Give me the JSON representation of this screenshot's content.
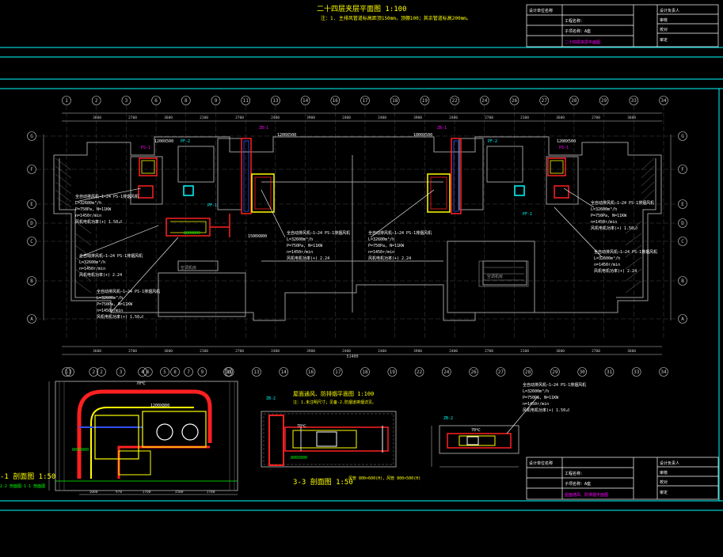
{
  "drawing": {
    "main_title": "二十四层夹层平面图 1:100",
    "main_note": "注：1. 主排风管道标高距顶150mm，顶棚100；其余管道标高200mm。",
    "sub_title_1": "屋面通风、防排烟平面图 1:100",
    "sub_note_1": "注：1.未注明尺寸；见备-2.防烟道排烟详见。",
    "section_a_title": "-1 剖面图 1:50",
    "section_a_sub": "2-2 剖面图-1-1 剖面图",
    "section_b_title": "3-3 剖面图 1:50",
    "section_b_note": "风管 800×600(H)，风管 800×500(H)"
  },
  "grid": {
    "top_axes": [
      "1",
      "2",
      "3",
      "6",
      "8",
      "9",
      "11",
      "13",
      "14",
      "16",
      "17",
      "18",
      "19",
      "22",
      "24",
      "26",
      "27",
      "28",
      "29",
      "33",
      "34"
    ],
    "bottom_axes": [
      "1",
      "2",
      "3",
      "6",
      "8",
      "9",
      "11",
      "13",
      "14",
      "16",
      "17",
      "18",
      "19",
      "22",
      "24",
      "26",
      "27",
      "28",
      "29",
      "30",
      "31",
      "33",
      "34"
    ],
    "row_axes": [
      "G",
      "F",
      "E",
      "D",
      "C",
      "B",
      "A"
    ],
    "section_axes": [
      "1",
      "2",
      "4",
      "5",
      "7",
      "10"
    ],
    "total_width": "51400",
    "top_dims": [
      "3600",
      "2700",
      "3600",
      "2100",
      "2700",
      "2400",
      "3900",
      "2400",
      "2400",
      "3900",
      "2400",
      "2700",
      "2100",
      "3600",
      "2700",
      "3600"
    ],
    "section_dims": [
      "1000",
      "970",
      "1700",
      "1500",
      "1700"
    ]
  },
  "labels": {
    "ps1": "PS-1",
    "ps2": "PS-2",
    "pf1": "PF-1",
    "pf2": "PF-2",
    "zb1": "ZB-1",
    "zb2": "ZB-2",
    "duct_a": "1200X500",
    "duct_b": "1000X500",
    "duct_c": "1500X800",
    "duct_d": "800X800",
    "duct_e": "1200X800",
    "temp": "70℃",
    "eq_room": "空调机房",
    "fan_spec_1": "全自动排风机—1—24 PS-1排烟风机",
    "fan_spec_2": "L=32600m³/h",
    "fan_spec_3": "P=750Pa, N=11KW",
    "fan_spec_4": "n=1450r/min",
    "fan_spec_5": "风机电机功率(+) 1.50⊿",
    "fan_spec_6": "n=1450r/min",
    "fan_spec_7": "风机电机功率(+) 2.24"
  },
  "title_block": {
    "company": "设计单位名称",
    "project": "工程名称：",
    "sub_item": "子项名称：A座",
    "drawing_name_1": "二十四层夹层平面图",
    "drawing_name_2": "屋面通风、防排烟平面图",
    "sign_1": "设计负责人",
    "sign_2": "审核",
    "sign_3": "校对",
    "approver": "审定"
  },
  "colors": {
    "frame": "#00ffff",
    "wall": "#9a9a9a",
    "duct_red": "#ff2020",
    "duct_yellow": "#ffff00",
    "duct_blue": "#3050ff",
    "dim": "#c8c8c8",
    "leader": "#ffffff",
    "magenta": "#ff00ff",
    "green": "#00ff00"
  }
}
